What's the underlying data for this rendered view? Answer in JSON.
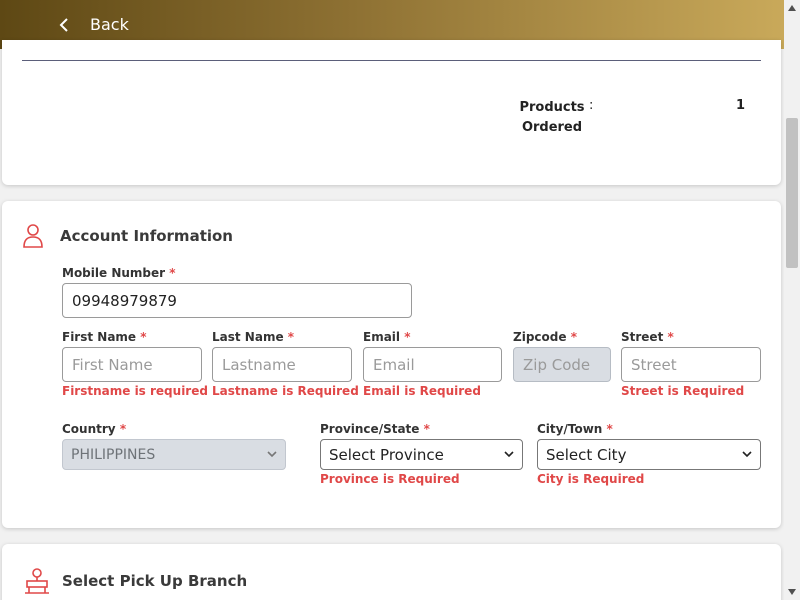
{
  "header": {
    "back_label": "Back"
  },
  "summary": {
    "products_label_line1": "Products",
    "products_label_line2": "Ordered",
    "colon": ":",
    "products_value": "1"
  },
  "account": {
    "title": "Account Information",
    "required_mark": "*",
    "mobile": {
      "label": "Mobile Number",
      "value": "09948979879"
    },
    "first_name": {
      "label": "First Name",
      "placeholder": "First Name",
      "error": "Firstname is required"
    },
    "last_name": {
      "label": "Last Name",
      "placeholder": "Lastname",
      "error": "Lastname is Required"
    },
    "email": {
      "label": "Email",
      "placeholder": "Email",
      "error": "Email is Required"
    },
    "zipcode": {
      "label": "Zipcode",
      "placeholder": "Zip Code"
    },
    "street": {
      "label": "Street",
      "placeholder": "Street",
      "error": "Street is Required"
    },
    "country": {
      "label": "Country",
      "selected": "PHILIPPINES"
    },
    "province": {
      "label": "Province/State",
      "selected": "Select Province",
      "error": "Province is Required"
    },
    "city": {
      "label": "City/Town",
      "selected": "Select City",
      "error": "City is Required"
    }
  },
  "branch": {
    "title": "Select Pick Up Branch"
  },
  "colors": {
    "accent_red": "#e04848",
    "header_dark": "#5e4814",
    "header_light": "#c9a95a"
  },
  "icons": {
    "back": "chevron-left-icon",
    "account": "user-icon",
    "branch": "store-icon"
  }
}
